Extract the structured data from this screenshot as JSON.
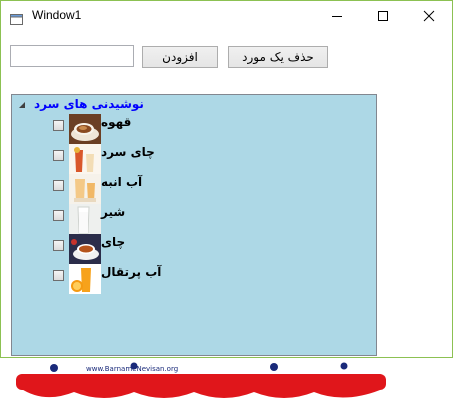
{
  "window": {
    "title": "Window1"
  },
  "toolbar": {
    "input_value": "",
    "add_button_label": "افزودن",
    "delete_button_label": "حذف یک مورد"
  },
  "tree": {
    "root_label": "نوشیدنی های سرد",
    "items": [
      {
        "label": "قهوه",
        "icon": "coffee-cup-image"
      },
      {
        "label": "چای سرد",
        "icon": "iced-tea-image"
      },
      {
        "label": "آب انبه",
        "icon": "mango-juice-image"
      },
      {
        "label": "شیر",
        "icon": "milk-glass-image"
      },
      {
        "label": "چای",
        "icon": "tea-cup-image"
      },
      {
        "label": "آب پرتقال",
        "icon": "orange-juice-image"
      }
    ]
  },
  "watermark": {
    "url_text": "www.BarnameNevisan.org"
  },
  "colors": {
    "tree_background": "#add8e6",
    "root_label": "#0000ff",
    "window_border": "#8cc152",
    "logo_red": "#e0161b",
    "logo_blue": "#1a2a7a"
  }
}
